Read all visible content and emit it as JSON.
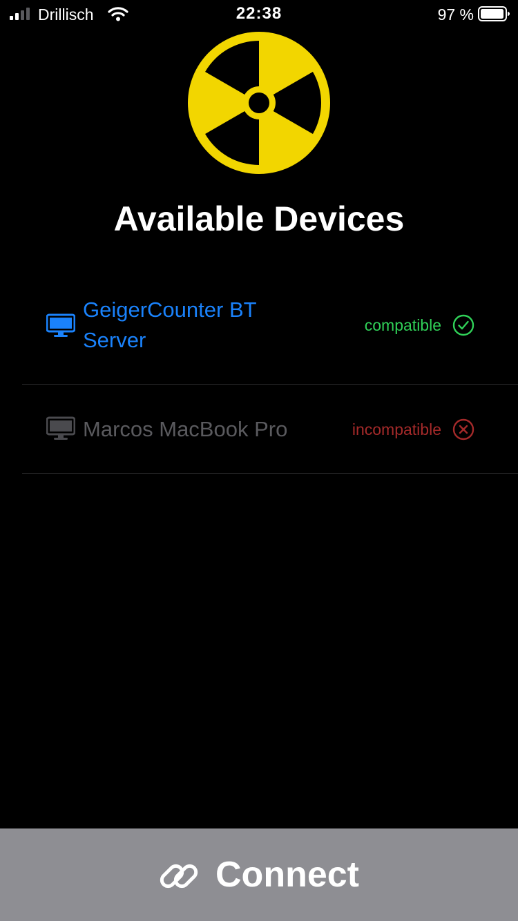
{
  "status_bar": {
    "carrier": "Drillisch",
    "time": "22:38",
    "battery_percent": "97 %",
    "battery_level": 0.97,
    "signal_bars": 2,
    "icons": [
      "signal-icon",
      "wifi-icon",
      "battery-icon"
    ]
  },
  "logo": {
    "icon": "radiation-icon",
    "color": "#f2d600"
  },
  "title": "Available Devices",
  "devices": [
    {
      "name": "GeigerCounter BT Server",
      "status": "compatible",
      "status_icon": "checkmark-circle-icon",
      "device_icon": "desktop-icon",
      "name_color": "#1a82fb",
      "status_color": "#30d158"
    },
    {
      "name": "Marcos MacBook Pro",
      "status": "incompatible",
      "status_icon": "xmark-circle-icon",
      "device_icon": "desktop-icon",
      "name_color": "#5a5a5e",
      "status_color": "#a52a2a"
    }
  ],
  "connect_button": {
    "label": "Connect",
    "icon": "link-icon",
    "background": "#8e8e93"
  }
}
